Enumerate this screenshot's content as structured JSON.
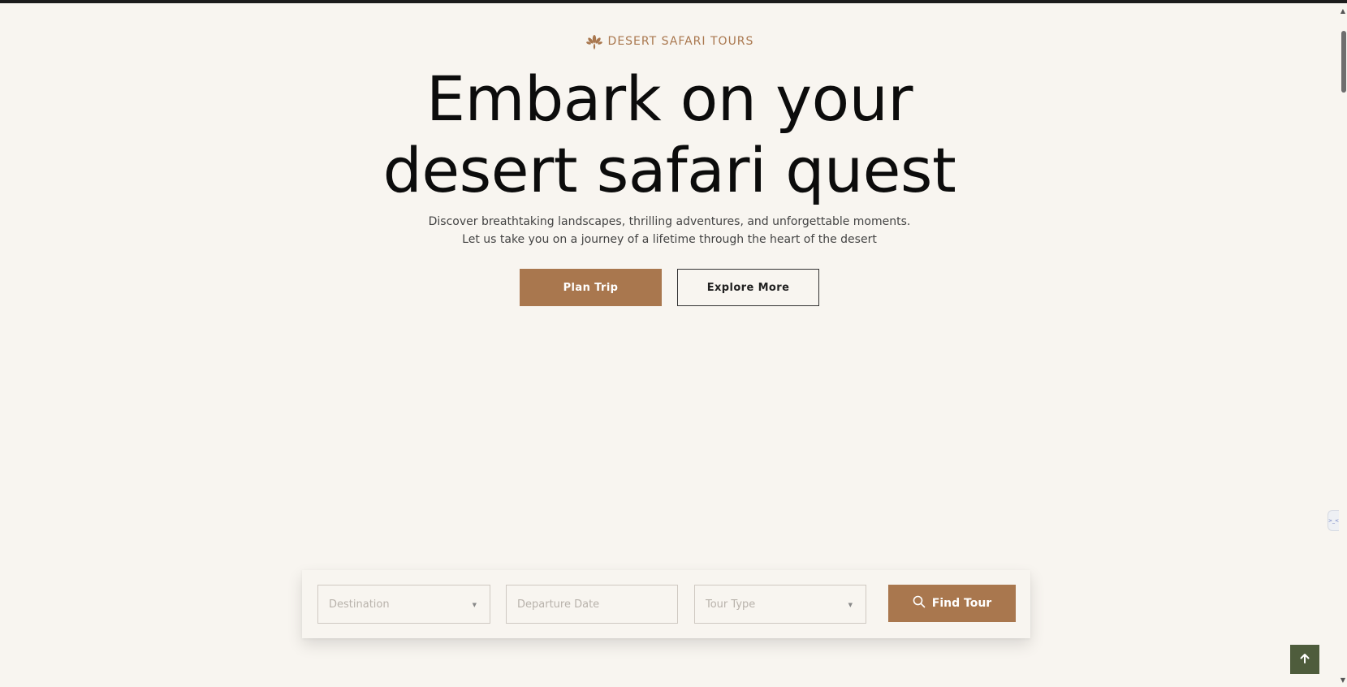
{
  "hero": {
    "eyebrow": "DESERT SAFARI TOURS",
    "eyebrow_icon": "lotus-icon",
    "title_line1": "Embark on your",
    "title_line2": "desert safari quest",
    "subtitle_line1": "Discover breathtaking landscapes, thrilling adventures, and unforgettable moments.",
    "subtitle_line2": "Let us take you on a journey of a lifetime through the heart of the desert",
    "primary_button": "Plan Trip",
    "secondary_button": "Explore More"
  },
  "search": {
    "destination_placeholder": "Destination",
    "departure_placeholder": "Departure Date",
    "tour_type_placeholder": "Tour Type",
    "find_button": "Find Tour",
    "find_icon": "search-icon"
  },
  "widgets": {
    "back_to_top_icon": "arrow-up-icon",
    "side_widget_label": ">_<"
  },
  "colors": {
    "accent": "#a9774e",
    "background": "#f8f5f0",
    "back_to_top": "#4e5c3c",
    "text_dark": "#0c0c0c"
  }
}
